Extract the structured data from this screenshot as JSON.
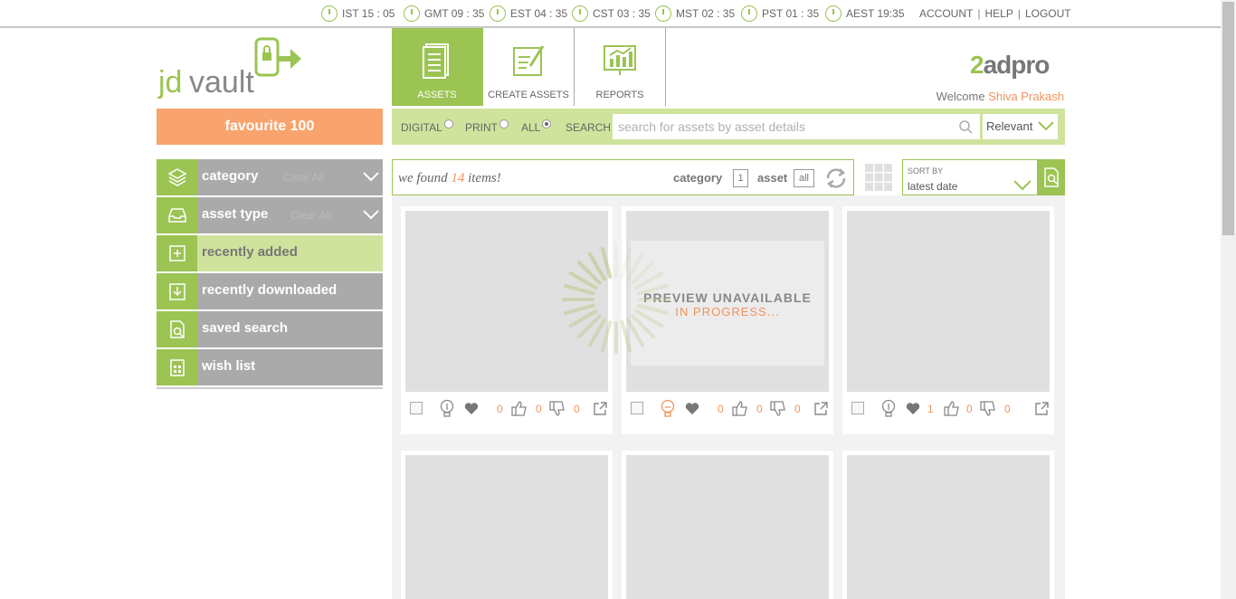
{
  "clocks": [
    {
      "label": "IST 15 : 05"
    },
    {
      "label": "GMT 09 : 35"
    },
    {
      "label": "EST 04 : 35"
    },
    {
      "label": "CST 03 : 35"
    },
    {
      "label": "MST 02 : 35"
    },
    {
      "label": "PST 01 : 35"
    },
    {
      "label": "AEST 19:35"
    }
  ],
  "toplinks": {
    "account": "ACCOUNT",
    "help": "HELP",
    "logout": "LOGOUT",
    "sep": "|"
  },
  "logo": {
    "text_a": "jd",
    "text_b": "vault"
  },
  "nav": {
    "assets": "ASSETS",
    "create": "CREATE ASSETS",
    "reports": "REPORTS"
  },
  "brand": {
    "two": "2",
    "rest": "adpro"
  },
  "welcome": {
    "prefix": "Welcome ",
    "user": "Shiva Prakash"
  },
  "favourite": "favourite 100",
  "search": {
    "digital": "DIGITAL",
    "print": "PRINT",
    "all": "ALL",
    "search_label": "SEARCH",
    "placeholder": "search for assets by asset details",
    "selected": "ALL",
    "sort_select": "Relevant"
  },
  "sidebar": {
    "category": "category",
    "category_clear": "Clear All",
    "asset_type": "asset type",
    "asset_type_clear": "Clear All",
    "recently_added": "recently added",
    "recently_downloaded": "recently downloaded",
    "saved_search": "saved search",
    "wish_list": "wish list"
  },
  "results": {
    "prefix": "we found ",
    "count": "14",
    "suffix": " items!",
    "category_label": "category",
    "category_value": "1",
    "asset_label": "asset",
    "asset_value": "all"
  },
  "sort": {
    "label": "SORT BY",
    "value": "latest date"
  },
  "cards": [
    {
      "likes_heart": "0",
      "thumbs_up": "0",
      "thumbs_down": "0",
      "idea_active": false
    },
    {
      "likes_heart": "0",
      "thumbs_up": "0",
      "thumbs_down": "0",
      "idea_active": true
    },
    {
      "likes_heart": "1",
      "thumbs_up": "0",
      "thumbs_down": "0",
      "idea_active": false
    }
  ],
  "preview": {
    "line1": "PREVIEW UNAVAILABLE",
    "line2": "IN PROGRESS..."
  },
  "colors": {
    "accent_green": "#9bc453",
    "light_green": "#cfe39d",
    "orange": "#f9a36e",
    "orange_text": "#f0935b",
    "sidebar_gray": "#aaaaaa"
  }
}
